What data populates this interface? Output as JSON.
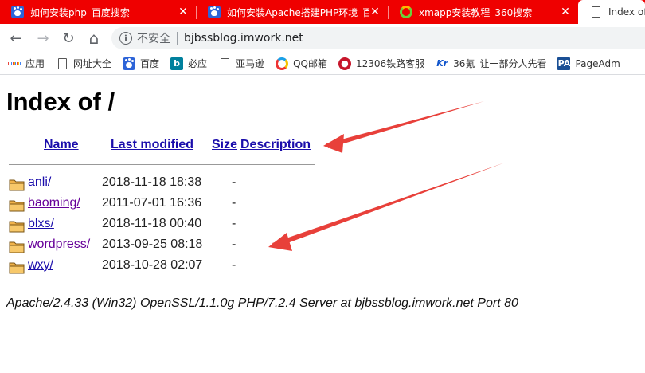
{
  "browser": {
    "tabs": [
      {
        "title": "如何安装php_百度搜索",
        "icon": "baidu-paw-icon",
        "close": "✕"
      },
      {
        "title": "如何安装Apache搭建PHP环境_百",
        "icon": "baidu-paw-icon",
        "close": "✕"
      },
      {
        "title": "xmapp安装教程_360搜索",
        "icon": "360-search-icon",
        "close": "✕"
      },
      {
        "title": "Index of",
        "icon": "document-icon"
      }
    ],
    "nav": {
      "back": "←",
      "forward": "→",
      "reload": "↻",
      "home": "⌂",
      "security_label": "不安全",
      "url": "bjbssblog.imwork.net"
    },
    "bookmarks": [
      {
        "label": "应用",
        "icon": "apps-grid-icon"
      },
      {
        "label": "网址大全",
        "icon": "page-icon"
      },
      {
        "label": "百度",
        "icon": "baidu-paw-icon"
      },
      {
        "label": "必应",
        "icon": "bing-icon"
      },
      {
        "label": "亚马逊",
        "icon": "page-icon"
      },
      {
        "label": "QQ邮箱",
        "icon": "qq-mail-icon"
      },
      {
        "label": "12306铁路客服",
        "icon": "12306-icon"
      },
      {
        "label": "36氪_让一部分人先看",
        "icon": "kr-icon"
      },
      {
        "label": "PageAdm",
        "icon": "pa-icon"
      }
    ]
  },
  "page": {
    "heading": "Index of /",
    "columns": {
      "name": "Name",
      "last_modified": "Last modified",
      "size": "Size",
      "description": "Description"
    },
    "entries": [
      {
        "name": "anli/",
        "modified": "2018-11-18 18:38",
        "size": "-",
        "visited": false
      },
      {
        "name": "baoming/",
        "modified": "2011-07-01 16:36",
        "size": "-",
        "visited": true
      },
      {
        "name": "blxs/",
        "modified": "2018-11-18 00:40",
        "size": "-",
        "visited": false
      },
      {
        "name": "wordpress/",
        "modified": "2013-09-25 08:18",
        "size": "-",
        "visited": true
      },
      {
        "name": "wxy/",
        "modified": "2018-10-28 02:07",
        "size": "-",
        "visited": false
      }
    ],
    "server_signature": "Apache/2.4.33 (Win32) OpenSSL/1.1.0g PHP/7.2.4 Server at bjbssblog.imwork.net Port 80"
  },
  "colors": {
    "tabstrip": "#ef0000",
    "link": "#1a0dab",
    "visited_link": "#660099",
    "annotation_arrow": "#e8403a"
  }
}
